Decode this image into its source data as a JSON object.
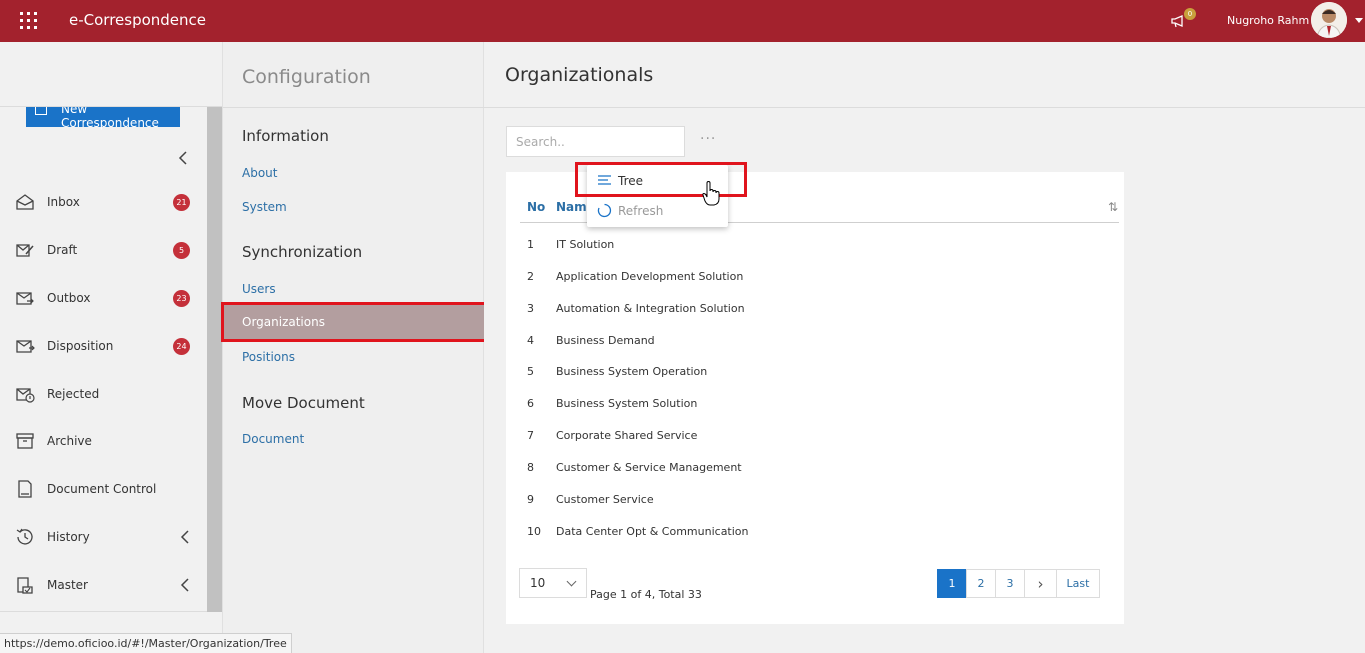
{
  "app": {
    "title": "e-Correspondence",
    "notification_count": "0"
  },
  "user": {
    "name": "Nugroho Rahm"
  },
  "sidebar": {
    "new_button": "New Correspondence",
    "items": [
      {
        "label": "Inbox",
        "badge": "21",
        "icon": "inbox-icon"
      },
      {
        "label": "Draft",
        "badge": "5",
        "icon": "draft-icon"
      },
      {
        "label": "Outbox",
        "badge": "23",
        "icon": "outbox-icon"
      },
      {
        "label": "Disposition",
        "badge": "24",
        "icon": "disposition-icon"
      },
      {
        "label": "Rejected",
        "badge": "",
        "icon": "rejected-icon"
      },
      {
        "label": "Archive",
        "badge": "",
        "icon": "archive-icon"
      },
      {
        "label": "Document Control",
        "badge": "",
        "icon": "document-control-icon"
      },
      {
        "label": "History",
        "badge": "",
        "icon": "history-icon"
      },
      {
        "label": "Master",
        "badge": "",
        "icon": "master-icon"
      }
    ],
    "partial_bottom": "Configuration"
  },
  "config": {
    "title": "Configuration",
    "sections": {
      "information": {
        "title": "Information",
        "links": [
          "About",
          "System"
        ]
      },
      "sync": {
        "title": "Synchronization",
        "links": [
          "Users",
          "Organizations",
          "Positions"
        ]
      },
      "move": {
        "title": "Move Document",
        "links": [
          "Document"
        ]
      }
    }
  },
  "main": {
    "title": "Organizationals",
    "search_placeholder": "Search..",
    "more": "···",
    "menu": [
      {
        "label": "Tree",
        "icon": "tree-list-icon"
      },
      {
        "label": "Refresh",
        "icon": "refresh-icon"
      }
    ],
    "table": {
      "headers": {
        "no": "No",
        "name": "Name"
      },
      "rows": [
        {
          "no": "1",
          "name": "IT Solution"
        },
        {
          "no": "2",
          "name": "Application Development Solution"
        },
        {
          "no": "3",
          "name": "Automation & Integration Solution"
        },
        {
          "no": "4",
          "name": "Business Demand"
        },
        {
          "no": "5",
          "name": "Business System Operation"
        },
        {
          "no": "6",
          "name": "Business System Solution"
        },
        {
          "no": "7",
          "name": "Corporate Shared Service"
        },
        {
          "no": "8",
          "name": "Customer & Service Management"
        },
        {
          "no": "9",
          "name": "Customer Service"
        },
        {
          "no": "10",
          "name": "Data Center Opt & Communication"
        }
      ]
    },
    "page_size": "10",
    "page_info": "Page 1 of 4, Total 33",
    "pager": [
      "1",
      "2",
      "3",
      "›",
      "Last"
    ]
  },
  "status_url": "https://demo.oficioo.id/#!/Master/Organization/Tree",
  "colors": {
    "brand": "#a3222d",
    "accent": "#1a73c8",
    "link": "#2c6fa6",
    "badge": "#c4303a",
    "highlight": "#e0141d"
  }
}
